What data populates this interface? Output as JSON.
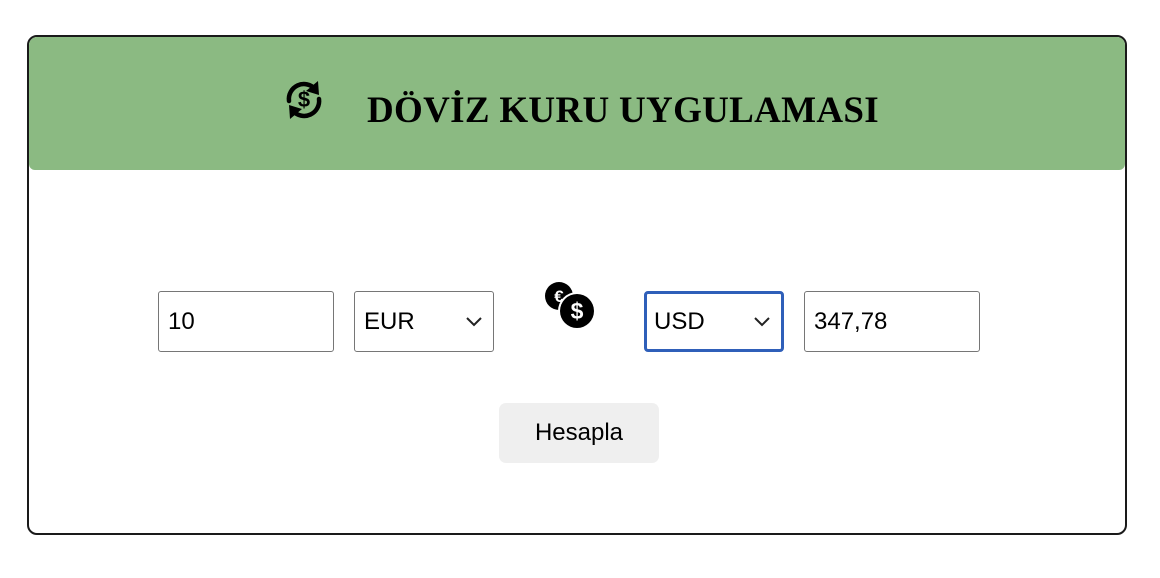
{
  "header": {
    "title": "DÖVİZ KURU UYGULAMASI",
    "icon": "currency-exchange-icon",
    "background_color": "#8bba82"
  },
  "converter": {
    "amount_value": "10",
    "from_currency": "EUR",
    "swap_icon": "euro-dollar-coins-icon",
    "to_currency": "USD",
    "result_value": "347,78",
    "focus_color": "#2f5fb9"
  },
  "actions": {
    "calculate_label": "Hesapla"
  }
}
